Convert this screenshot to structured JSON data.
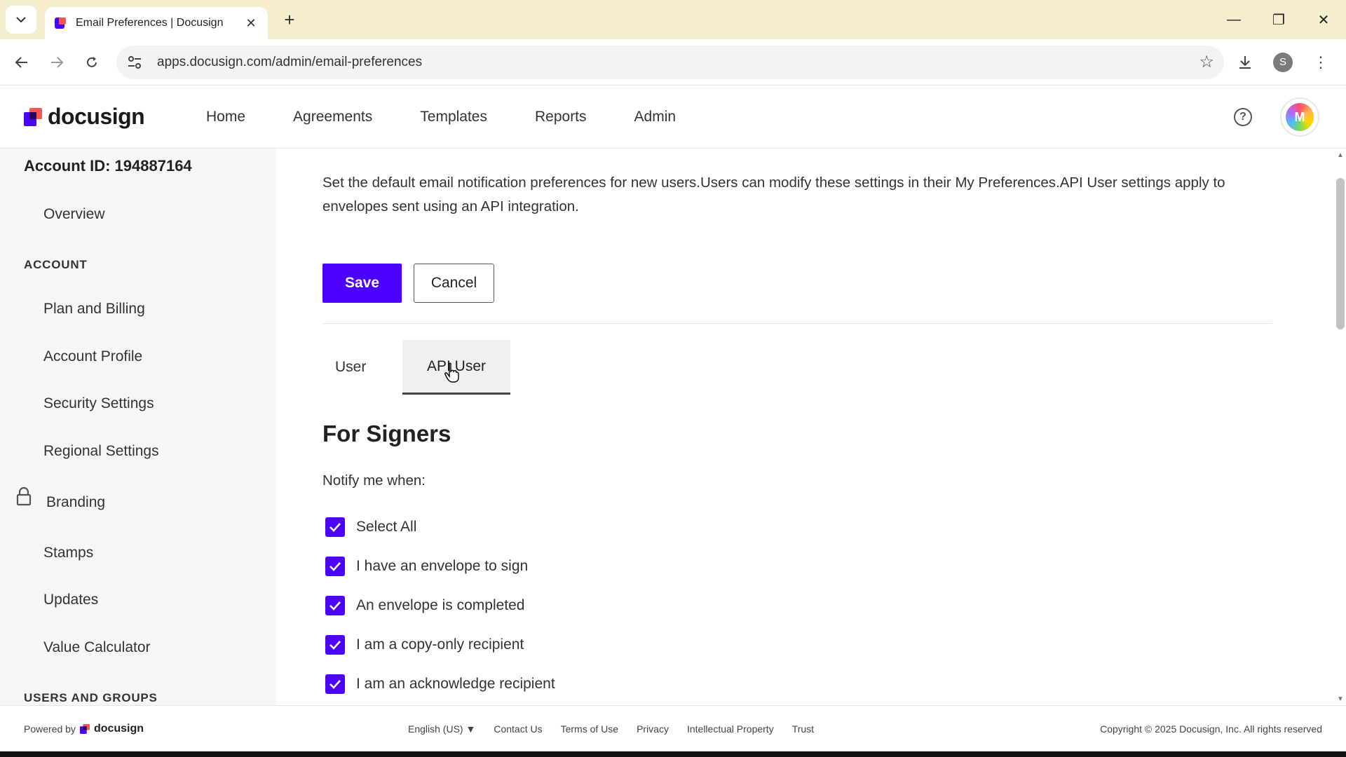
{
  "browser": {
    "tab_title": "Email Preferences | Docusign",
    "url": "apps.docusign.com/admin/email-preferences",
    "profile_initial": "S"
  },
  "header": {
    "logo_text": "docusign",
    "nav": [
      "Home",
      "Agreements",
      "Templates",
      "Reports",
      "Admin"
    ],
    "avatar_initial": "M"
  },
  "sidebar": {
    "account_id": "Account ID: 194887164",
    "overview": "Overview",
    "account_heading": "ACCOUNT",
    "items": [
      "Plan and Billing",
      "Account Profile",
      "Security Settings",
      "Regional Settings",
      "Branding",
      "Stamps",
      "Updates",
      "Value Calculator"
    ],
    "users_heading": "USERS AND GROUPS"
  },
  "main": {
    "intro": "Set the default email notification preferences for new users.Users can modify these settings in their My Preferences.API User settings apply to envelopes sent using an API integration.",
    "save_label": "Save",
    "cancel_label": "Cancel",
    "tabs": [
      "User",
      "API User"
    ],
    "active_tab": "API User",
    "section_title": "For Signers",
    "notify_label": "Notify me when:",
    "checkboxes": [
      {
        "label": "Select All",
        "checked": true
      },
      {
        "label": "I have an envelope to sign",
        "checked": true
      },
      {
        "label": "An envelope is completed",
        "checked": true
      },
      {
        "label": "I am a copy-only recipient",
        "checked": true
      },
      {
        "label": "I am an acknowledge recipient",
        "checked": true
      }
    ]
  },
  "footer": {
    "powered_by": "Powered by",
    "powered_logo": "docusign",
    "language": "English (US)",
    "links": [
      "Contact Us",
      "Terms of Use",
      "Privacy",
      "Intellectual Property",
      "Trust"
    ],
    "copyright": "Copyright © 2025 Docusign, Inc. All rights reserved"
  },
  "colors": {
    "brand_purple": "#4c00ff",
    "tabstrip": "#f5edce"
  }
}
